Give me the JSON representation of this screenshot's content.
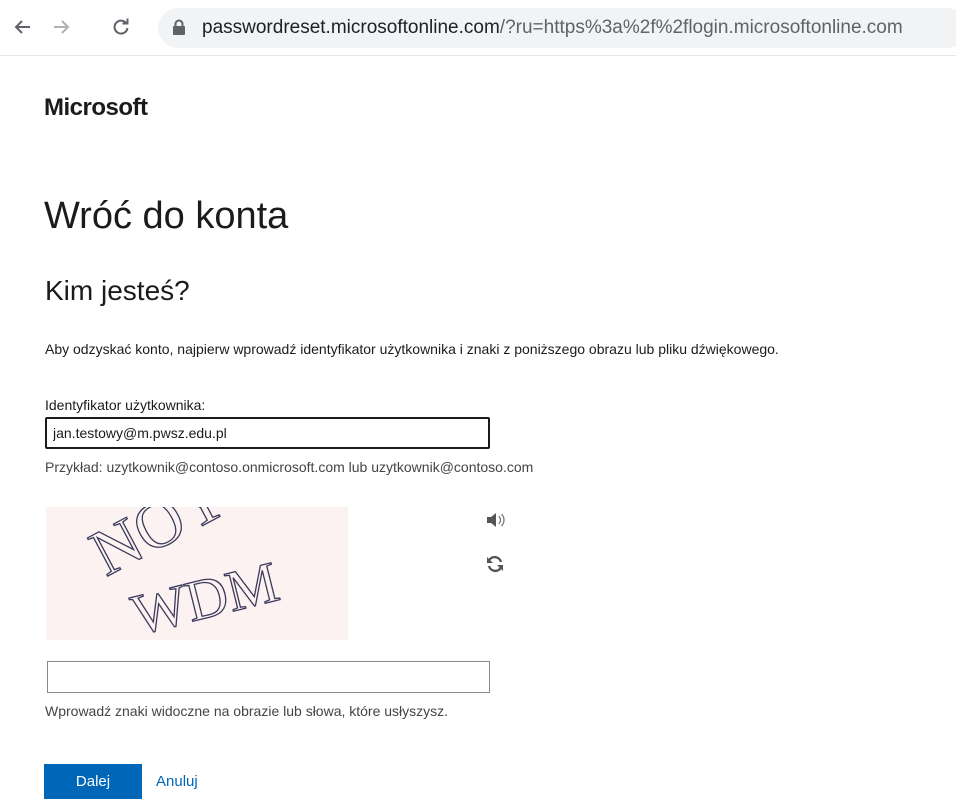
{
  "browser": {
    "url_host": "passwordreset.microsoftonline.com",
    "url_path": "/?ru=https%3a%2f%2flogin.microsoftonline.com"
  },
  "brand": {
    "name": "Microsoft"
  },
  "page": {
    "title": "Wróć do konta",
    "subtitle": "Kim jesteś?",
    "instructions": "Aby odzyskać konto, najpierw wprowadź identyfikator użytkownika i znaki z poniższego obrazu lub pliku dźwiękowego."
  },
  "form": {
    "userid_label": "Identyfikator użytkownika:",
    "userid_value": "jan.testowy@m.pwsz.edu.pl",
    "example_text": "Przykład: uzytkownik@contoso.onmicrosoft.com lub uzytkownik@contoso.com",
    "captcha_text": "NOY WDM",
    "captcha_value": "",
    "captcha_hint": "Wprowadź znaki widoczne na obrazie lub słowa, które usłyszysz."
  },
  "actions": {
    "next_label": "Dalej",
    "cancel_label": "Anuluj"
  },
  "icons": {
    "back": "back-arrow-icon",
    "forward": "forward-arrow-icon",
    "reload": "reload-icon",
    "lock": "lock-icon",
    "audio": "speaker-icon",
    "refresh": "refresh-icon"
  },
  "colors": {
    "accent": "#0067b8",
    "captcha_bg": "#fbf2f1"
  }
}
